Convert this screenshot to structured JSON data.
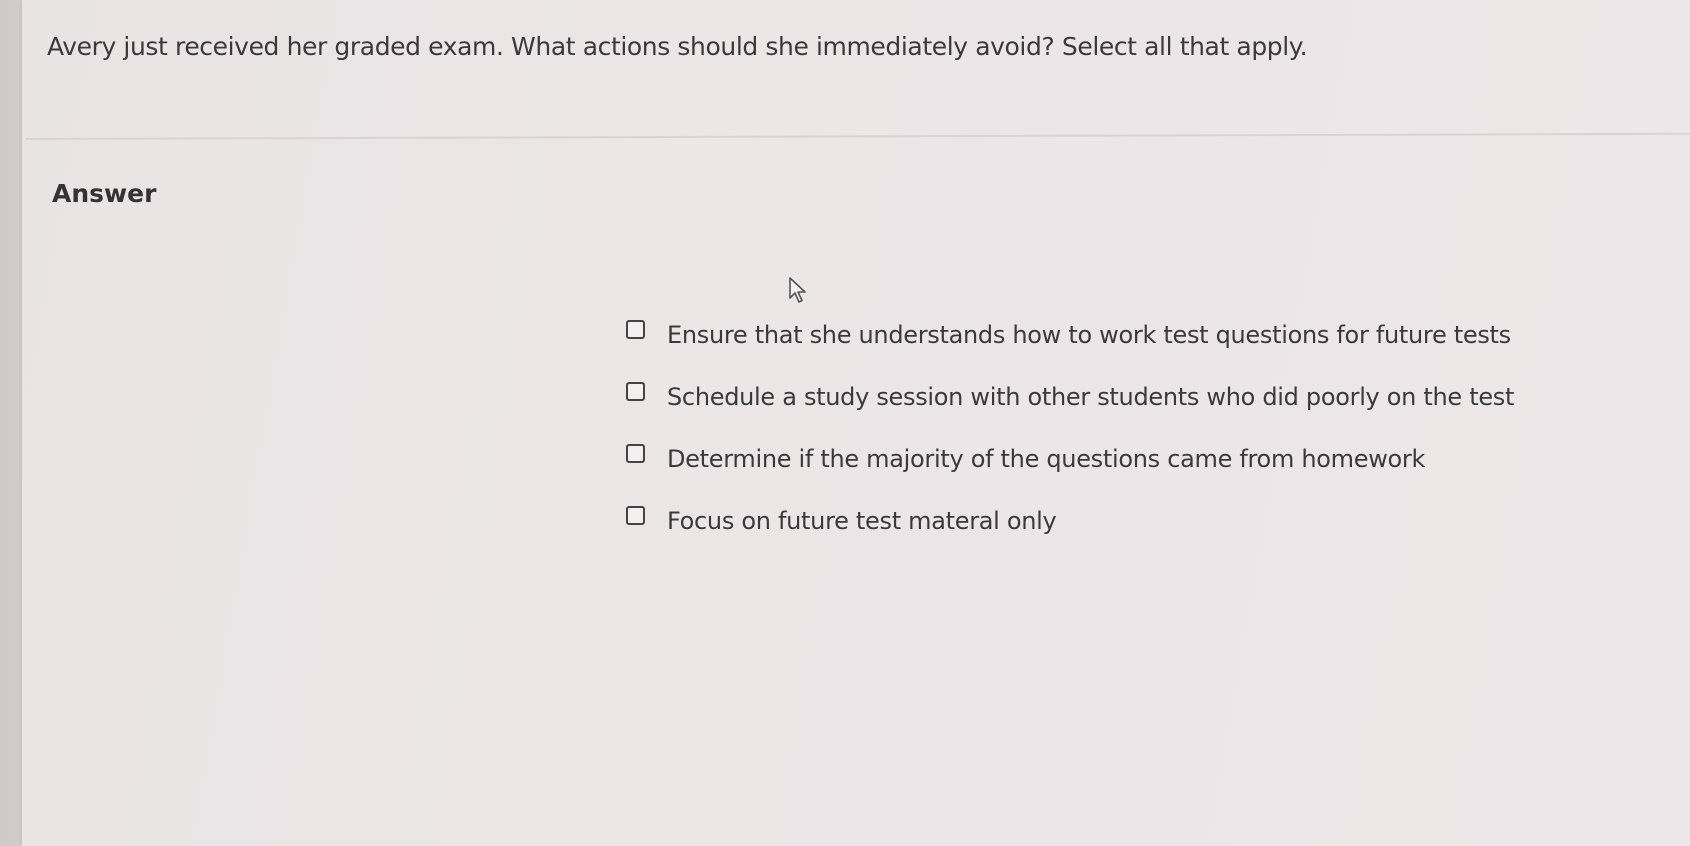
{
  "question": {
    "text": "Avery just received her graded exam. What actions should she immediately avoid? Select all that apply."
  },
  "answer": {
    "label": "Answer",
    "options": [
      {
        "label": "Ensure that she understands how to work test questions for future tests",
        "checked": false
      },
      {
        "label": "Schedule a study session with other students who did poorly on the test",
        "checked": false
      },
      {
        "label": "Determine if the majority of the questions came from homework",
        "checked": false
      },
      {
        "label": "Focus on future test materal only",
        "checked": false
      }
    ]
  },
  "icons": {
    "cursor": "mouse-pointer-icon"
  }
}
